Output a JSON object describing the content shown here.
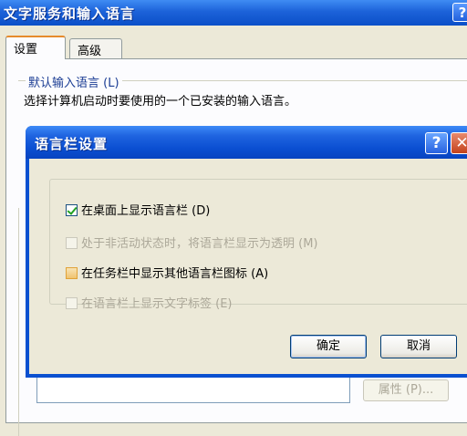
{
  "background_window": {
    "title": "文字服务和输入语言",
    "help_glyph": "?",
    "tabs": [
      {
        "label": "设置",
        "active": true
      },
      {
        "label": "高级",
        "active": false
      }
    ],
    "default_language_group": {
      "title": "默认输入语言 (L)",
      "description": "选择计算机启动时要使用的一个已安装的输入语言。"
    },
    "properties_button": "属性 (P)..."
  },
  "dialog": {
    "title": "语言栏设置",
    "help_glyph": "?",
    "close_glyph": "✕",
    "options": [
      {
        "label": "在桌面上显示语言栏 (D)",
        "checked": true,
        "enabled": true
      },
      {
        "label": "处于非活动状态时，将语言栏显示为透明 (M)",
        "checked": false,
        "enabled": false
      },
      {
        "label": "在任务栏中显示其他语言栏图标 (A)",
        "checked": false,
        "enabled": true
      },
      {
        "label": "在语言栏上显示文字标签 (E)",
        "checked": false,
        "enabled": false
      }
    ],
    "ok_button": "确定",
    "cancel_button": "取消"
  },
  "colors": {
    "titlebar_blue": "#0a4ed1",
    "close_red": "#c4421b",
    "dialog_face": "#ece9d8",
    "group_title_blue": "#1b3d94",
    "disabled_text": "#aca899"
  }
}
